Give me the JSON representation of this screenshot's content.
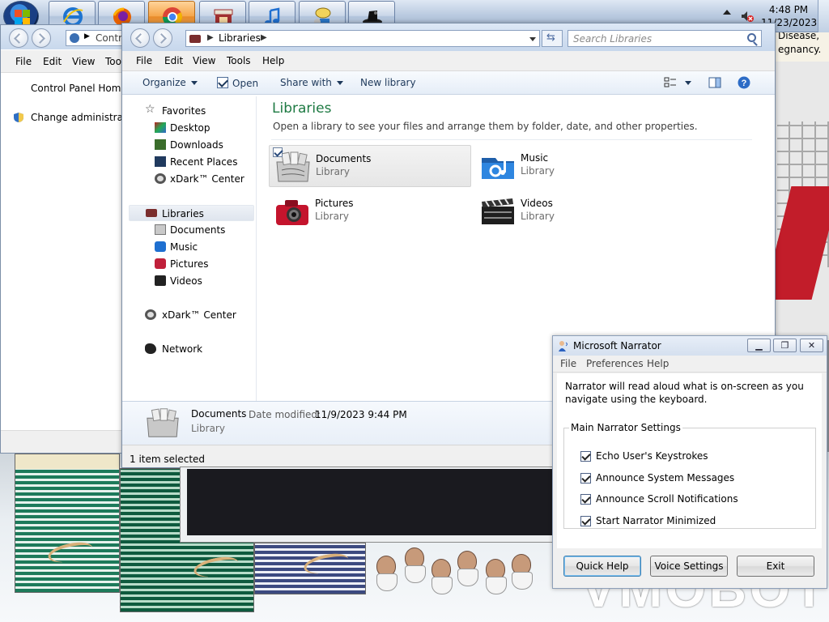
{
  "taskbar": {
    "buttons": [
      {
        "name": "internet-explorer",
        "icon": "ie-icon"
      },
      {
        "name": "firefox",
        "icon": "firefox-icon"
      },
      {
        "name": "chrome",
        "icon": "chrome-icon",
        "active": true
      },
      {
        "name": "store",
        "icon": "store-icon"
      },
      {
        "name": "itunes",
        "icon": "itunes-icon"
      },
      {
        "name": "messenger",
        "icon": "messenger-icon"
      },
      {
        "name": "hat-app",
        "icon": "hat-icon"
      }
    ],
    "clock_time": "4:48 PM",
    "clock_date": "11/23/2023"
  },
  "desktop": {
    "note_line1": "Disease,",
    "note_line2": "egnancy.",
    "watermark": "VMOBOT"
  },
  "control_panel": {
    "address_crumb": "Contr",
    "menu": {
      "file": "File",
      "edit": "Edit",
      "view": "View",
      "tools": "Too"
    },
    "home_link": "Control Panel Home",
    "admin_link": "Change administrativ"
  },
  "explorer": {
    "address_crumb": "Libraries",
    "search_placeholder": "Search Libraries",
    "menu": {
      "file": "File",
      "edit": "Edit",
      "view": "View",
      "tools": "Tools",
      "help": "Help"
    },
    "commands": {
      "organize": "Organize",
      "open": "Open",
      "share_with": "Share with",
      "new_library": "New library"
    },
    "nav": {
      "favorites": "Favorites",
      "desktop": "Desktop",
      "downloads": "Downloads",
      "recent_places": "Recent Places",
      "xdark1": "xDark™ Center",
      "libraries": "Libraries",
      "documents": "Documents",
      "music": "Music",
      "pictures": "Pictures",
      "videos": "Videos",
      "xdark2": "xDark™ Center",
      "network": "Network"
    },
    "content": {
      "title": "Libraries",
      "subtitle": "Open a library to see your files and arrange them by folder, date, and other properties.",
      "tiles": [
        {
          "name": "Documents",
          "type": "Library"
        },
        {
          "name": "Music",
          "type": "Library"
        },
        {
          "name": "Pictures",
          "type": "Library"
        },
        {
          "name": "Videos",
          "type": "Library"
        }
      ]
    },
    "details": {
      "name": "Documents",
      "type": "Library",
      "modified_label": "Date modified:",
      "modified_value": "11/9/2023 9:44 PM"
    },
    "status": "1 item selected"
  },
  "narrator": {
    "title": "Microsoft Narrator",
    "menu": {
      "file": "File",
      "preferences": "Preferences",
      "help": "Help"
    },
    "intro": "Narrator will read aloud what is on-screen as you navigate using the keyboard.",
    "group_title": "Main Narrator Settings",
    "options": [
      {
        "label": "Echo User's Keystrokes",
        "checked": true
      },
      {
        "label": "Announce System Messages",
        "checked": true
      },
      {
        "label": "Announce Scroll Notifications",
        "checked": true
      },
      {
        "label": "Start Narrator Minimized",
        "checked": true
      }
    ],
    "buttons": {
      "quick_help": "Quick Help",
      "voice_settings": "Voice Settings",
      "exit": "Exit"
    }
  }
}
